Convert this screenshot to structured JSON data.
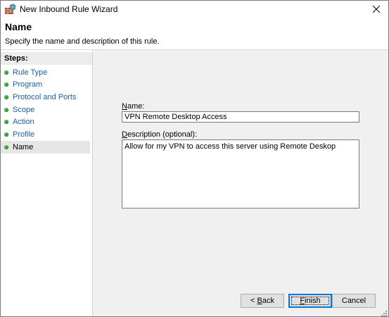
{
  "window": {
    "title": "New Inbound Rule Wizard",
    "app_icon": "firewall-icon",
    "close_icon": "close-icon"
  },
  "header": {
    "title": "Name",
    "subtitle": "Specify the name and description of this rule."
  },
  "steps": {
    "label": "Steps:",
    "items": [
      {
        "label": "Rule Type",
        "status": "complete"
      },
      {
        "label": "Program",
        "status": "complete"
      },
      {
        "label": "Protocol and Ports",
        "status": "complete"
      },
      {
        "label": "Scope",
        "status": "complete"
      },
      {
        "label": "Action",
        "status": "complete"
      },
      {
        "label": "Profile",
        "status": "complete"
      },
      {
        "label": "Name",
        "status": "current"
      }
    ],
    "status_color": "#44b649"
  },
  "form": {
    "name_label_access": "N",
    "name_label_rest": "ame:",
    "name_value": "VPN Remote Desktop Access",
    "desc_label_access": "D",
    "desc_label_rest": "escription (optional):",
    "desc_value": "Allow for my VPN to access this server using Remote Deskop"
  },
  "buttons": {
    "back_prefix": "< ",
    "back_access": "B",
    "back_rest": "ack",
    "finish_access": "F",
    "finish_rest": "inish",
    "cancel": "Cancel"
  },
  "colors": {
    "default_button_border": "#0078d7",
    "link_step": "#1a5fb4"
  }
}
